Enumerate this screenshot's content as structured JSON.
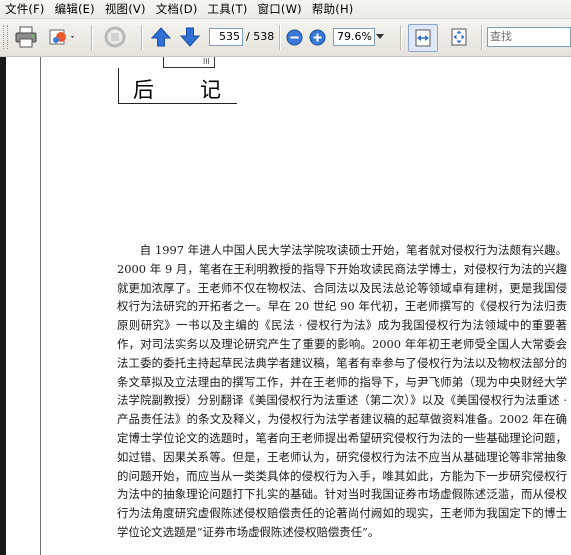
{
  "menu": {
    "items": [
      "文件(F)",
      "编辑(E)",
      "视图(V)",
      "文档(D)",
      "工具(T)",
      "窗口(W)",
      "帮助(H)"
    ]
  },
  "toolbar": {
    "current_page": "535",
    "total_pages": "/ 538",
    "zoom": "79.6%",
    "search_placeholder": "查找"
  },
  "document": {
    "heading": "后记",
    "heading_mark": "lll",
    "paragraph": "自 1997 年进人中国人民大学法学院攻读硕士开始，笔者就对侵权行为法颇有兴趣。2000 年 9 月，笔者在王利明教授的指导下开始攻读民商法学博士，对侵权行为法的兴趣就更加浓厚了。王老师不仅在物权法、合同法以及民法总论等领域卓有建树，更是我国侵权行为法研究的开拓者之一。早在 20 世纪 90 年代初，王老师撰写的《侵权行为法归责原则研究》一书以及主编的《民法 · 侵权行为法》成为我国侵权行为法领域中的重要著作，对司法实务以及理论研究产生了重要的影响。2000 年年初王老师受全国人大常委会法工委的委托主持起草民法典学者建议稿，笔者有幸参与了侵权行为法以及物权法部分的条文草拟及立法理由的撰写工作，并在王老师的指导下，与尹飞师弟（现为中央财经大学法学院副教授）分别翻译《美国侵权行为法重述（第二次）》以及《美国侵权行为法重述 · 产品责任法》的条文及释义，为侵权行为法学者建议稿的起草做资料准备。2002 年在确定博士学位论文的选题时，笔者向王老师提出希望研究侵权行为法的一些基础理论问题，如过错、因果关系等。但是，王老师认为，研究侵权行为法不应当从基础理论等非常抽象的问题开始，而应当从一类类具体的侵权行为入手，唯其如此，方能为下一步研究侵权行为法中的抽象理论问题打下扎实的基础。针对当时我国证券市场虚假陈述泛滥，而从侵权行为法角度研究虚假陈述侵权赔偿责任的论著尚付阙如的现实，王老师为我国定下的博士学位论文选题是“证券市场虚假陈述侵权赔偿责任”。"
  },
  "colors": {
    "toolbar_bg": "#ecebe6",
    "arrow_blue": "#2f6fd6",
    "zoom_circle_blue": "#3a78d8"
  },
  "icons": [
    "print-icon",
    "email-icon",
    "sync-icon",
    "prev-page-icon",
    "next-page-icon",
    "zoom-out-icon",
    "zoom-in-icon",
    "fit-width-icon",
    "fit-page-icon"
  ]
}
